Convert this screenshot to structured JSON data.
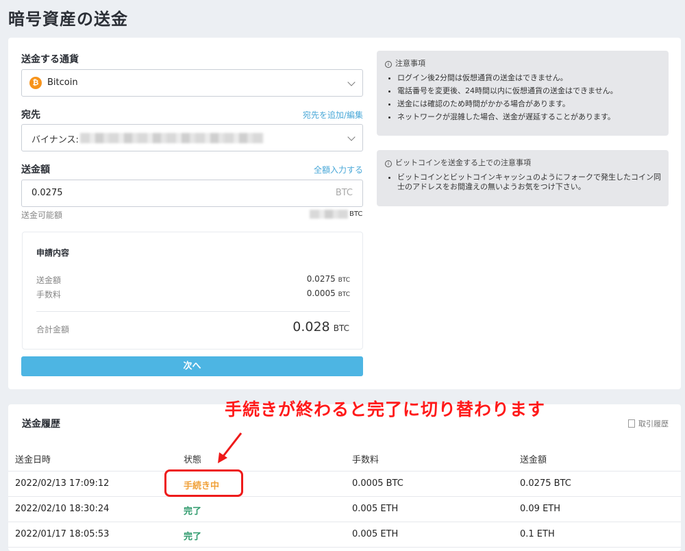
{
  "page": {
    "title": "暗号資産の送金"
  },
  "form": {
    "currency_label": "送金する通貨",
    "currency_value": "Bitcoin",
    "currency_icon": "bitcoin-icon",
    "dest_label": "宛先",
    "dest_link": "宛先を追加/編集",
    "dest_value": "バイナンス:",
    "amount_label": "送金額",
    "amount_link": "全額入力する",
    "amount_value": "0.0275",
    "amount_unit": "BTC",
    "available_label": "送金可能額",
    "available_unit": "BTC"
  },
  "summary": {
    "title": "申請内容",
    "rows": [
      {
        "label": "送金額",
        "value": "0.0275",
        "unit": "BTC"
      },
      {
        "label": "手数料",
        "value": "0.0005",
        "unit": "BTC"
      }
    ],
    "total_label": "合計金額",
    "total_value": "0.028",
    "total_unit": "BTC"
  },
  "next_button": "次へ",
  "notice1": {
    "title": "注意事項",
    "items": [
      "ログイン後2分間は仮想通貨の送金はできません。",
      "電話番号を変更後、24時間以内に仮想通貨の送金はできません。",
      "送金には確認のため時間がかかる場合があります。",
      "ネットワークが混雑した場合、送金が遅延することがあります。"
    ]
  },
  "notice2": {
    "title": "ビットコインを送金する上での注意事項",
    "items": [
      "ビットコインとビットコインキャッシュのようにフォークで発生したコイン同士のアドレスをお間違えの無いようお気をつけ下さい。"
    ]
  },
  "history": {
    "title": "送金履歴",
    "link": "取引履歴",
    "headers": [
      "送金日時",
      "状態",
      "手数料",
      "送金額"
    ],
    "rows": [
      {
        "date": "2022/02/13 17:09:12",
        "status": "手続き中",
        "fee": "0.0005 BTC",
        "amount": "0.0275 BTC"
      },
      {
        "date": "2022/02/10 18:30:24",
        "status": "完了",
        "fee": "0.005 ETH",
        "amount": "0.09 ETH"
      },
      {
        "date": "2022/01/17 18:05:53",
        "status": "完了",
        "fee": "0.005 ETH",
        "amount": "0.1 ETH"
      }
    ]
  },
  "annotation": {
    "text": "手続きが終わると完了に切り替わります"
  },
  "colors": {
    "accent": "#4db5e3",
    "pending": "#f0a13a",
    "done": "#2e9a6c",
    "annotation": "#ff1a1a",
    "bitcoin": "#f7931a"
  }
}
